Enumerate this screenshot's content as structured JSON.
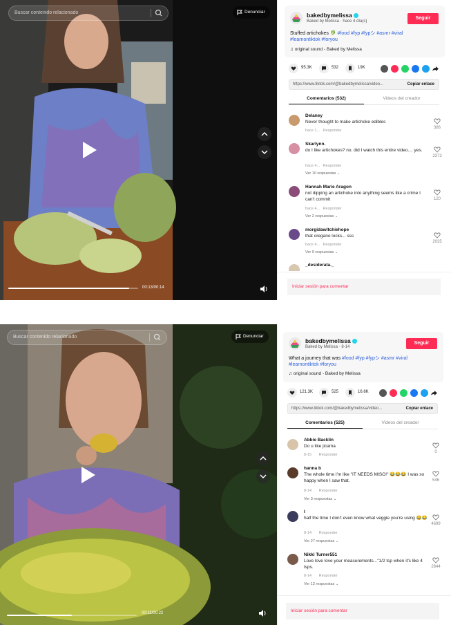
{
  "panels": [
    {
      "video": {
        "search_placeholder": "Buscar contenido relacionado",
        "report_label": "Denunciar",
        "time": "00:13/00:14",
        "progress": 0.93
      },
      "post": {
        "author": "bakedbymelissa",
        "meta": "Baked by Melissa · hace 4 día(s)",
        "follow_label": "Seguir",
        "description": "Stuffed artichokes 🥬",
        "hashtags": "#food #fyp #fypシ #asmr #viral #learnontiktok #foryou",
        "sound": "original sound - Baked by Melissa",
        "likes": "95.3K",
        "comments": "532",
        "saves": "19K",
        "link": "https://www.tiktok.com/@bakedbymelissa/video...",
        "copy_label": "Copiar enlace",
        "tab_comments": "Comentarios (532)",
        "tab_videos": "Videos del creador"
      },
      "comments": [
        {
          "user": "Delaney",
          "text": "Never thought to make artichoke edibles",
          "time": "hace 1...",
          "reply": "Responder",
          "likes": "386",
          "replies": ""
        },
        {
          "user": "Skarlynn.",
          "text": "do I like artichokes? no. did I watch this entire video.... yes.",
          "time": "hace 4...",
          "reply": "Responder",
          "likes": "2373",
          "replies": "Ver 10 respuestas"
        },
        {
          "user": "Hannah Marie Aragon",
          "text": "not dipping an artichoke into anything seems like a crime I can't commit",
          "time": "hace 4...",
          "reply": "Responder",
          "likes": "120",
          "replies": "Ver 2 respuestas"
        },
        {
          "user": "morgidawitchiehope",
          "text": "that oregano locks... sss",
          "time": "hace 4...",
          "reply": "Responder",
          "likes": "2035",
          "replies": "Ver 9 respuestas"
        },
        {
          "user": "_desiderata._",
          "text": "",
          "time": "",
          "reply": "",
          "likes": "",
          "replies": ""
        }
      ],
      "login_label": "Iniciar sesión para comentar"
    },
    {
      "video": {
        "search_placeholder": "Buscar contenido relacionado",
        "report_label": "Denunciar",
        "time": "00:11/00:22",
        "progress": 0.5
      },
      "post": {
        "author": "bakedbymelissa",
        "meta": "Baked by Melissa · 8-14",
        "follow_label": "Seguir",
        "description": "What a journey that was",
        "hashtags": "#food #fyp #fypシ #asmr #viral #learnontiktok #foryou",
        "sound": "original sound - Baked by Melissa",
        "likes": "121.3K",
        "comments": "525",
        "saves": "16.6K",
        "link": "https://www.tiktok.com/@bakedbymelissa/video...",
        "copy_label": "Copiar enlace",
        "tab_comments": "Comentarios (525)",
        "tab_videos": "Videos del creador"
      },
      "comments": [
        {
          "user": "Abbie Backlin",
          "text": "Do u like jicama",
          "time": "8-15",
          "reply": "Responder",
          "likes": "0",
          "replies": ""
        },
        {
          "user": "hanna b",
          "text": "The whole time I'm like \"IT NEEDS MISO!\" 😂😂😂 I was so happy when I saw that.",
          "time": "8-14",
          "reply": "Responder",
          "likes": "546",
          "replies": "Ver 3 respuestas"
        },
        {
          "user": "I",
          "text": "half the time I don't even know what veggie you're using 😂😂",
          "time": "8-14",
          "reply": "Responder",
          "likes": "4699",
          "replies": "Ver 27 respuestas"
        },
        {
          "user": "Nikki Turner551",
          "text": "Love love love your measurements...\"1/2 tsp when it's like 4 tsps.",
          "time": "8-14",
          "reply": "Responder",
          "likes": "2844",
          "replies": "Ver 12 respuestas"
        }
      ],
      "login_label": "Iniciar sesión para comentar"
    }
  ],
  "colors": {
    "accent": "#fe2c55",
    "hashtag": "#2b5fd9",
    "verified": "#20d5ec"
  }
}
